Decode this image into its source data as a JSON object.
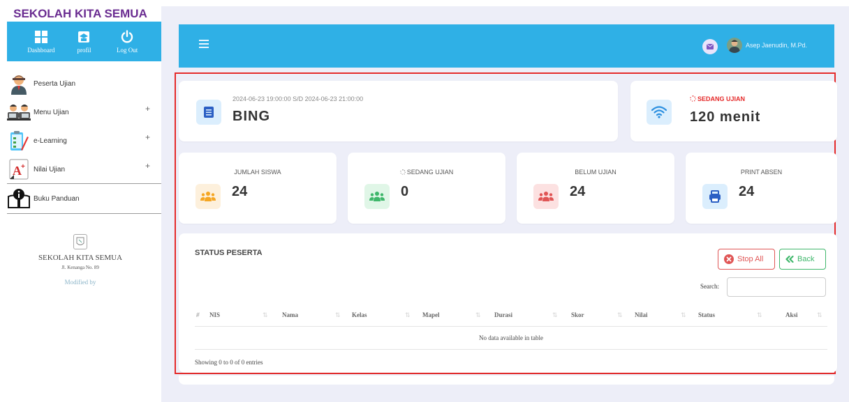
{
  "sidebar": {
    "school_title": "SEKOLAH KITA SEMUA",
    "topnav": [
      {
        "label": "Dashboard",
        "icon": "grid-icon"
      },
      {
        "label": "profil",
        "icon": "graduation-cap-icon"
      },
      {
        "label": "Log Out",
        "icon": "power-icon"
      }
    ],
    "menu": [
      {
        "label": "Peserta Ujian",
        "icon": "student-icon",
        "expandable": false
      },
      {
        "label": "Menu Ujian",
        "icon": "group-icon",
        "expandable": true,
        "toggle": "+"
      },
      {
        "label": "e-Learning",
        "icon": "clipboard-icon",
        "expandable": true,
        "toggle": "+"
      },
      {
        "label": "Nilai Ujian",
        "icon": "grade-icon",
        "expandable": true,
        "toggle": "+"
      },
      {
        "label": "Buku Panduan",
        "icon": "book-icon",
        "expandable": false
      }
    ],
    "school": {
      "name": "SEKOLAH KITA SEMUA",
      "address": "Jl. Kenanga No. 89",
      "modified_by": "Modified by"
    }
  },
  "header": {
    "user_name": "Asep Jaenudin, M.Pd."
  },
  "exam": {
    "time_range": "2024-06-23 19:00:00 S/D 2024-06-23 21:00:00",
    "name": "BING",
    "status": "SEDANG UJIAN",
    "duration": "120 menit"
  },
  "stats": [
    {
      "label": "JUMLAH SISWA",
      "value": "24",
      "icon": "users-icon",
      "color": "#f5a623",
      "bg": "#fdf0dc"
    },
    {
      "label": "SEDANG UJIAN",
      "value": "0",
      "icon": "users-icon",
      "color": "#3fb76b",
      "bg": "#e0f6e7"
    },
    {
      "label": "BELUM UJIAN",
      "value": "24",
      "icon": "users-icon",
      "color": "#e05555",
      "bg": "#fce1e1"
    },
    {
      "label": "PRINT ABSEN",
      "value": "24",
      "icon": "printer-icon",
      "color": "#2b5fc4",
      "bg": "#dbeefd"
    }
  ],
  "table": {
    "title": "STATUS PESERTA",
    "stop_all": "Stop All",
    "back": "Back",
    "search_label": "Search:",
    "search_value": "",
    "columns": [
      "#",
      "NIS",
      "Nama",
      "Kelas",
      "Mapel",
      "Durasi",
      "Skor",
      "Nilai",
      "Status",
      "Aksi"
    ],
    "empty_message": "No data available in table",
    "showing": "Showing 0 to 0 of 0 entries"
  },
  "colors": {
    "brand": "#2fb0e6",
    "highlight": "#e52a2a",
    "school_title": "#6a2c91"
  }
}
